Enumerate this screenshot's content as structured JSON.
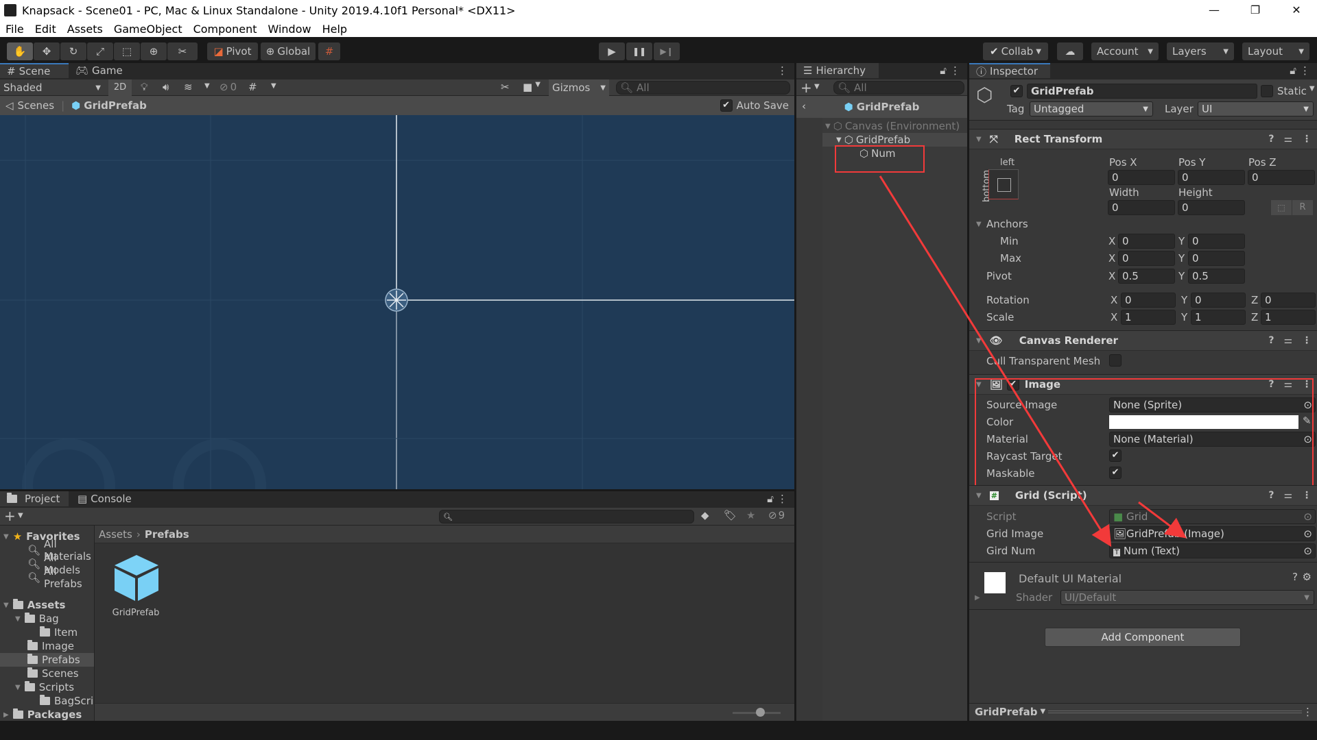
{
  "window": {
    "title": "Knapsack - Scene01 - PC, Mac & Linux Standalone - Unity 2019.4.10f1 Personal* <DX11>",
    "controls": {
      "minimize": "—",
      "maximize": "❐",
      "close": "✕"
    }
  },
  "menu": [
    "File",
    "Edit",
    "Assets",
    "GameObject",
    "Component",
    "Window",
    "Help"
  ],
  "toolbar": {
    "tools": [
      "hand-tool",
      "move-tool",
      "rotate-tool",
      "scale-tool",
      "rect-tool",
      "transform-tool",
      "custom-tool"
    ],
    "pivot_label": "Pivot",
    "global_label": "Global",
    "play": "▶",
    "pause": "❚❚",
    "step": "▶❙",
    "collab_label": "Collab",
    "account_label": "Account",
    "layers_label": "Layers",
    "layout_label": "Layout"
  },
  "scene_panel": {
    "tabs": [
      {
        "label": "Scene",
        "icon": "#"
      },
      {
        "label": "Game",
        "icon": "gamepad"
      }
    ],
    "shading_mode": "Shaded",
    "mode_2d": "2D",
    "hidden_count": "0",
    "gizmos_label": "Gizmos",
    "search_placeholder": "All",
    "breadcrumb": {
      "root": "Scenes",
      "current": "GridPrefab"
    },
    "auto_save_label": "Auto Save",
    "auto_save_checked": true
  },
  "hierarchy": {
    "tab_label": "Hierarchy",
    "search_placeholder": "All",
    "prefab_header": "GridPrefab",
    "items": [
      {
        "label": "Canvas (Environment)",
        "depth": 0,
        "expanded": true,
        "dimmed": true
      },
      {
        "label": "GridPrefab",
        "depth": 1,
        "expanded": true,
        "dimmed": false
      },
      {
        "label": "Num",
        "depth": 2,
        "expanded": false,
        "dimmed": false
      }
    ]
  },
  "inspector": {
    "tab_label": "Inspector",
    "object_name": "GridPrefab",
    "active": true,
    "static_label": "Static",
    "tag_label": "Tag",
    "tag_value": "Untagged",
    "layer_label": "Layer",
    "layer_value": "UI",
    "rect_transform": {
      "title": "Rect Transform",
      "anchor_preset_h": "left",
      "anchor_preset_v": "bottom",
      "pos_x_label": "Pos X",
      "pos_y_label": "Pos Y",
      "pos_z_label": "Pos Z",
      "pos_x": "0",
      "pos_y": "0",
      "pos_z": "0",
      "width_label": "Width",
      "height_label": "Height",
      "width": "0",
      "height": "0",
      "raw_button": "R",
      "anchors_label": "Anchors",
      "min_label": "Min",
      "min_x": "0",
      "min_y": "0",
      "max_label": "Max",
      "max_x": "0",
      "max_y": "0",
      "pivot_label": "Pivot",
      "pivot_x": "0.5",
      "pivot_y": "0.5",
      "rotation_label": "Rotation",
      "rot_x": "0",
      "rot_y": "0",
      "rot_z": "0",
      "scale_label": "Scale",
      "scale_x": "1",
      "scale_y": "1",
      "scale_z": "1",
      "x": "X",
      "y": "Y",
      "z": "Z"
    },
    "canvas_renderer": {
      "title": "Canvas Renderer",
      "cull_label": "Cull Transparent Mesh",
      "cull_checked": false
    },
    "image": {
      "title": "Image",
      "enabled": true,
      "source_image_label": "Source Image",
      "source_image_value": "None (Sprite)",
      "color_label": "Color",
      "color_value": "#ffffff",
      "material_label": "Material",
      "material_value": "None (Material)",
      "raycast_label": "Raycast Target",
      "raycast_checked": true,
      "maskable_label": "Maskable",
      "maskable_checked": true
    },
    "grid_script": {
      "title": "Grid (Script)",
      "script_label": "Script",
      "script_value": "Grid",
      "grid_image_label": "Grid Image",
      "grid_image_value": "GridPrefab (Image)",
      "gird_num_label": "Gird Num",
      "gird_num_value": "Num (Text)"
    },
    "material": {
      "title": "Default UI Material",
      "shader_label": "Shader",
      "shader_value": "UI/Default"
    },
    "add_component_label": "Add Component",
    "preview_label": "GridPrefab"
  },
  "project": {
    "tabs": [
      {
        "label": "Project"
      },
      {
        "label": "Console"
      }
    ],
    "hidden_count": "9",
    "favorites_label": "Favorites",
    "favorites": [
      "All Materials",
      "All Models",
      "All Prefabs"
    ],
    "tree": [
      {
        "label": "Assets",
        "depth": 0,
        "expanded": true,
        "bold": true
      },
      {
        "label": "Bag",
        "depth": 1,
        "expanded": true
      },
      {
        "label": "Item",
        "depth": 2
      },
      {
        "label": "Image",
        "depth": 1
      },
      {
        "label": "Prefabs",
        "depth": 1,
        "selected": true
      },
      {
        "label": "Scenes",
        "depth": 1
      },
      {
        "label": "Scripts",
        "depth": 1,
        "expanded": true
      },
      {
        "label": "BagScripts",
        "depth": 2
      },
      {
        "label": "Packages",
        "depth": 0,
        "collapsed": true,
        "bold": true
      }
    ],
    "breadcrumb": {
      "root": "Assets",
      "current": "Prefabs"
    },
    "assets": [
      {
        "name": "GridPrefab",
        "type": "prefab"
      }
    ],
    "icon_size_fraction": 0.2
  },
  "colors": {
    "annotation_red": "#f23a3a",
    "prefab_blue": "#79d0f5",
    "scene_bg": "#1f3a56",
    "selection_blue": "#3a79bb"
  }
}
